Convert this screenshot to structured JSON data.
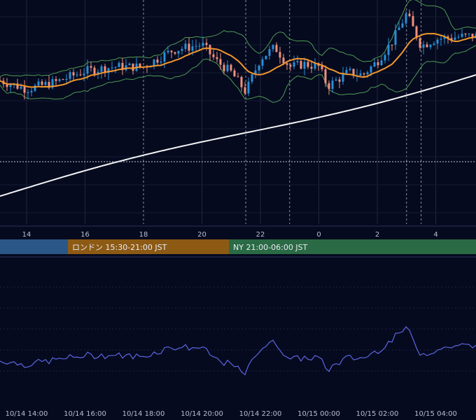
{
  "chart_data": [
    {
      "type": "candlestick",
      "x_axis_ticks": [
        "14",
        "16",
        "18",
        "20",
        "22",
        "0",
        "2",
        "4"
      ],
      "y_axis_ticks": [],
      "overlays": [
        {
          "role": "moving-average-short",
          "color": "#f0962e"
        },
        {
          "role": "moving-average-long",
          "color": "#f4f4f4"
        },
        {
          "role": "bollinger-bands",
          "color": "#4f9a52"
        }
      ],
      "candle_colors": {
        "up": "#2a8fd6",
        "down": "#f0907c"
      },
      "approx_hour_shape": [
        [
          13.1,
          0.48
        ],
        [
          14.0,
          0.42
        ],
        [
          15.0,
          0.47
        ],
        [
          16.0,
          0.55
        ],
        [
          17.0,
          0.58
        ],
        [
          18.0,
          0.58
        ],
        [
          19.0,
          0.7
        ],
        [
          20.0,
          0.74
        ],
        [
          20.5,
          0.62
        ],
        [
          21.0,
          0.54
        ],
        [
          21.5,
          0.4
        ],
        [
          22.0,
          0.64
        ],
        [
          22.5,
          0.72
        ],
        [
          23.0,
          0.58
        ],
        [
          23.5,
          0.6
        ],
        [
          0.0,
          0.58
        ],
        [
          0.3,
          0.44
        ],
        [
          1.0,
          0.54
        ],
        [
          1.5,
          0.52
        ],
        [
          2.0,
          0.62
        ],
        [
          2.5,
          0.76
        ],
        [
          3.0,
          0.96
        ],
        [
          3.5,
          0.73
        ],
        [
          4.0,
          0.78
        ],
        [
          5.0,
          0.8
        ]
      ]
    },
    {
      "type": "line",
      "role": "oscillator",
      "color": "#5c66e0",
      "x_axis_ticks": [
        "10/14 14:00",
        "10/14 16:00",
        "10/14 18:00",
        "10/14 20:00",
        "10/14 22:00",
        "10/15 00:00",
        "10/15 02:00",
        "10/15 04:00"
      ]
    }
  ],
  "sessions": [
    {
      "label": "",
      "color": "#2a5788"
    },
    {
      "label": "ロンドン 15:30-21:00 JST",
      "color": "#8d5a14"
    },
    {
      "label": "NY 21:00-06:00 JST",
      "color": "#2a6a44"
    }
  ]
}
